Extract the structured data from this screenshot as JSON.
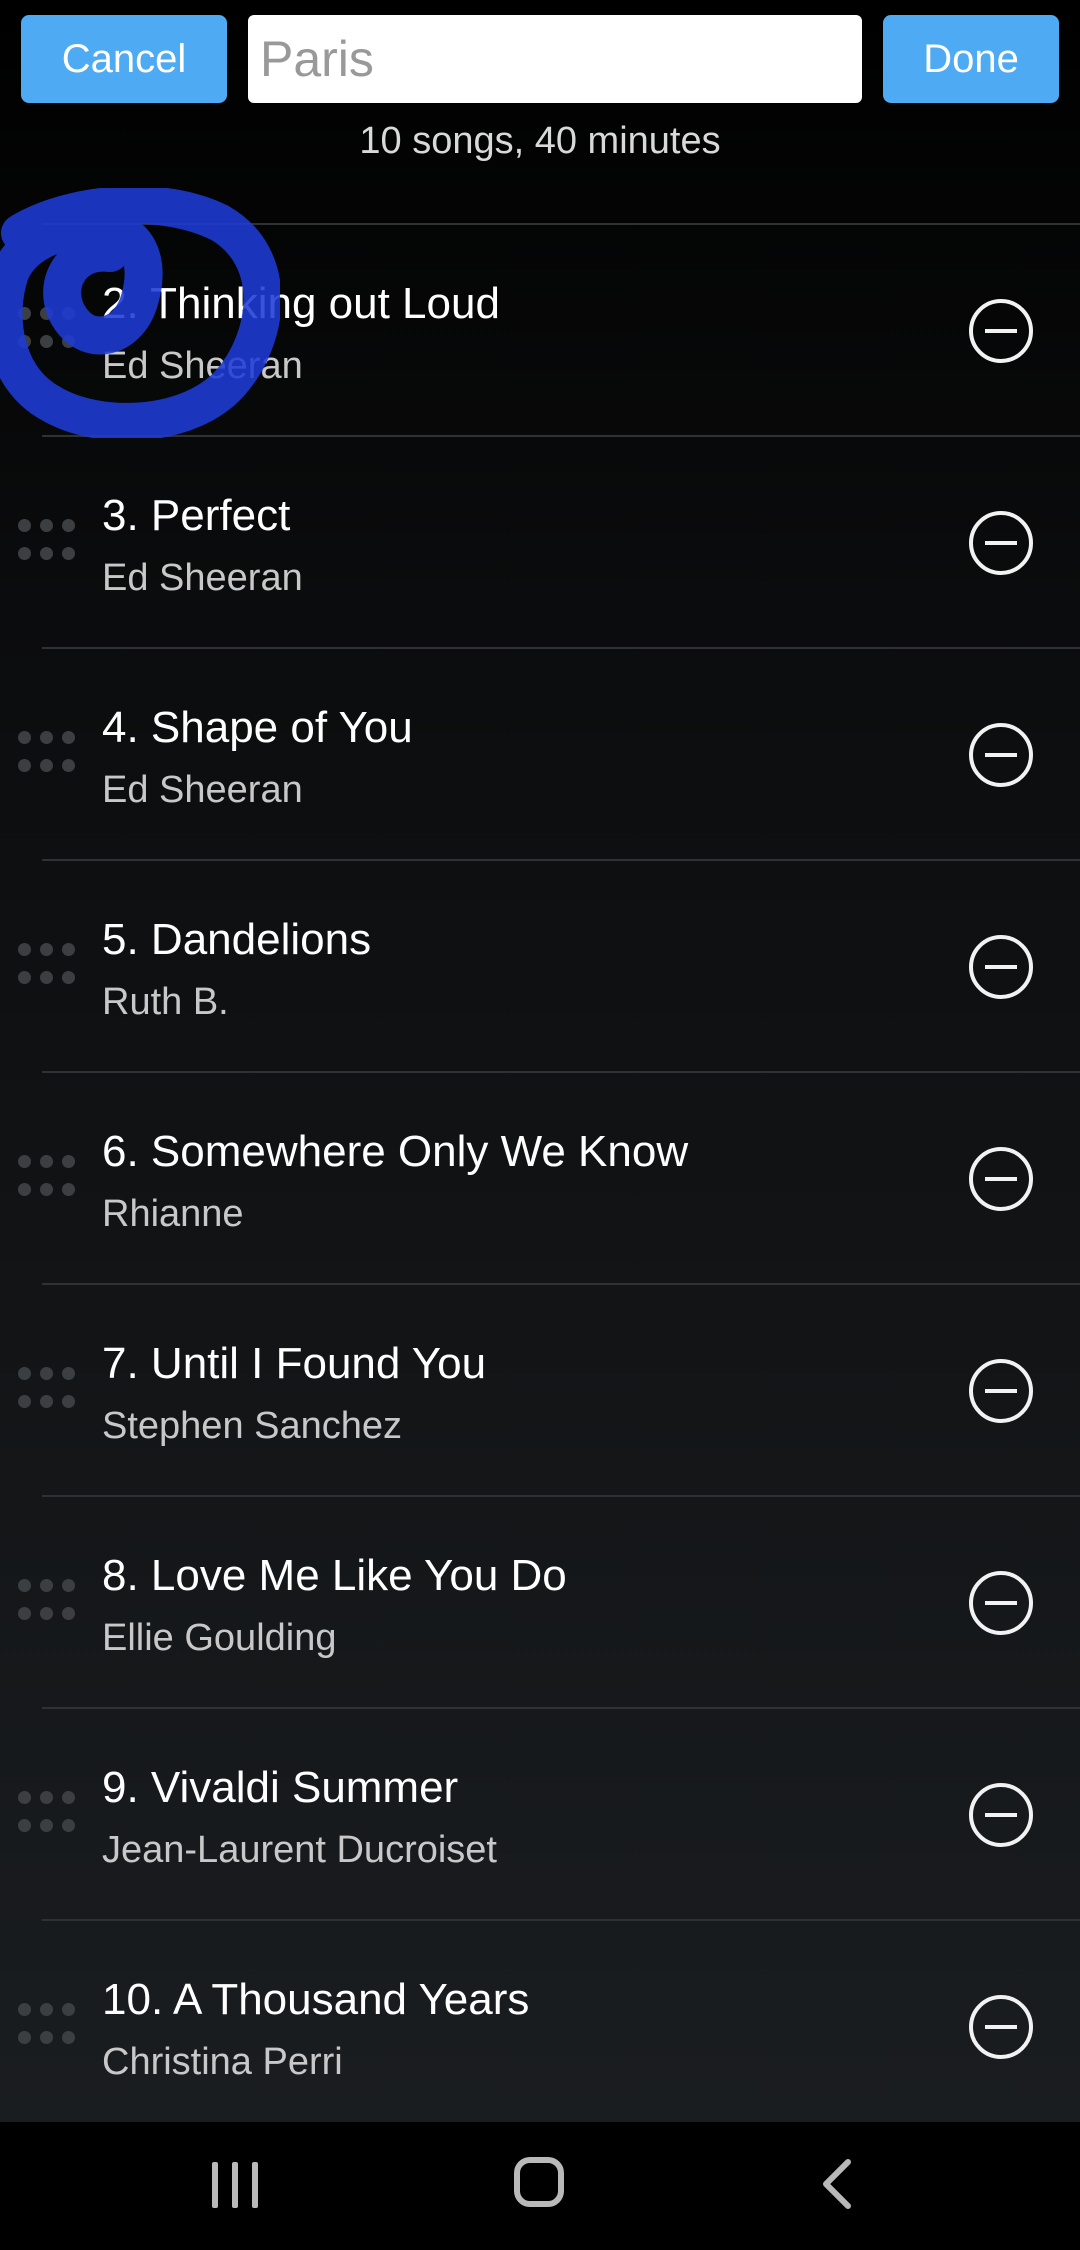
{
  "header": {
    "cancel_label": "Cancel",
    "done_label": "Done",
    "playlist_name_placeholder": "Paris",
    "summary": "10 songs, 40 minutes"
  },
  "songs": [
    {
      "title": "2. Thinking out Loud",
      "artist": "Ed Sheeran"
    },
    {
      "title": "3. Perfect",
      "artist": "Ed Sheeran"
    },
    {
      "title": "4. Shape of You",
      "artist": "Ed Sheeran"
    },
    {
      "title": "5. Dandelions",
      "artist": "Ruth B."
    },
    {
      "title": "6. Somewhere Only We Know",
      "artist": "Rhianne"
    },
    {
      "title": "7. Until I Found You",
      "artist": "Stephen Sanchez"
    },
    {
      "title": "8. Love Me Like You Do",
      "artist": "Ellie Goulding"
    },
    {
      "title": "9. Vivaldi Summer",
      "artist": "Jean-Laurent Ducroiset"
    },
    {
      "title": "10. A Thousand Years",
      "artist": "Christina Perri"
    }
  ],
  "colors": {
    "accent": "#4eaaf2",
    "annotation": "#1f3bd6"
  },
  "icons": {
    "drag": "drag-handle-icon",
    "remove": "remove-circle-icon",
    "nav_recents": "recents-icon",
    "nav_home": "home-icon",
    "nav_back": "back-icon"
  }
}
